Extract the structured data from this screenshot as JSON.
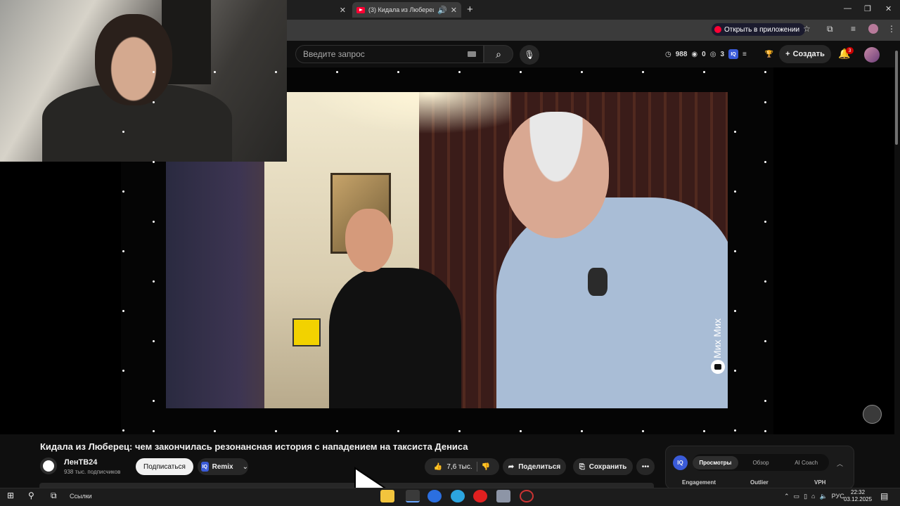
{
  "browser": {
    "tabs": [
      {
        "label": "",
        "active": false
      },
      {
        "label": "(3) Кидала из Люберец: че",
        "active": true
      }
    ],
    "open_in_app_label": "Открыть в приложении"
  },
  "youtube_header": {
    "search_placeholder": "Введите запрос",
    "stats": {
      "views": "988",
      "likes": "0",
      "comments": "3"
    },
    "create_label": "Создать",
    "notifications_count": "3"
  },
  "video": {
    "watermark": "Мих Мих",
    "title": "Кидала из Люберец: чем закончилась резонансная история с нападением на таксиста Дениса"
  },
  "channel": {
    "name": "ЛенТВ24",
    "subscribers": "938 тыс. подписчиков",
    "subscribe_label": "Подписаться",
    "remix_label": "Remix"
  },
  "actions": {
    "likes": "7,6 тыс.",
    "share_label": "Поделиться",
    "save_label": "Сохранить"
  },
  "vidiq_panel": {
    "logo": "IQ",
    "tabs": [
      "Просмотры",
      "Обзор",
      "AI Coach"
    ],
    "active_tab": "Просмотры",
    "columns": [
      "Engagement",
      "Outlier",
      "VPH"
    ]
  },
  "taskbar": {
    "links_label": "Ссылки",
    "language": "РУС",
    "time": "22:32",
    "date": "03.12.2025"
  },
  "colors": {
    "yt_red": "#ff0033",
    "bg": "#0f0f0f",
    "pill": "#272727",
    "vidiq_blue": "#3a5bd9"
  }
}
